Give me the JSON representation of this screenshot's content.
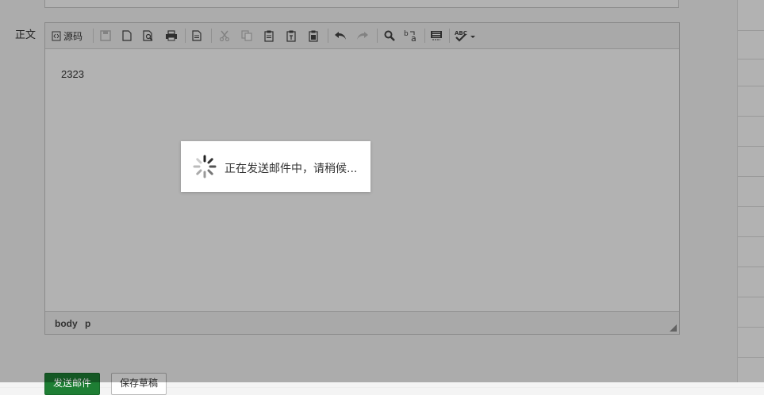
{
  "background": {
    "rows": [
      {
        "text": "",
        "date": ""
      },
      {
        "text": "",
        "date": ""
      },
      {
        "text": "",
        "date": ""
      },
      {
        "text": "",
        "date": ""
      },
      {
        "text": "",
        "date": ""
      },
      {
        "text": "",
        "date": ""
      },
      {
        "text": "",
        "date": ""
      },
      {
        "text": "",
        "date": ""
      },
      {
        "text": "",
        "date": ""
      },
      {
        "text": "",
        "date": ""
      },
      {
        "text": "",
        "date": ""
      },
      {
        "text": "",
        "date": ""
      }
    ]
  },
  "compose": {
    "body_label": "正文",
    "toolbar": {
      "source_label": "源码",
      "icons": [
        "source-icon",
        "save-icon",
        "new-page-icon",
        "preview-icon",
        "print-icon",
        "templates-icon",
        "cut-icon",
        "copy-icon",
        "paste-icon",
        "paste-text-icon",
        "paste-word-icon",
        "undo-icon",
        "redo-icon",
        "find-icon",
        "replace-icon",
        "select-all-icon",
        "spellcheck-icon"
      ]
    },
    "content_text": "2323",
    "status_path": [
      "body",
      "p"
    ],
    "send_label": "发送邮件",
    "save_label": "保存草稿"
  },
  "loading": {
    "message": "正在发送邮件中，请稍候..."
  },
  "colors": {
    "overlay": "#000000",
    "send_button": "#1e7e34"
  }
}
